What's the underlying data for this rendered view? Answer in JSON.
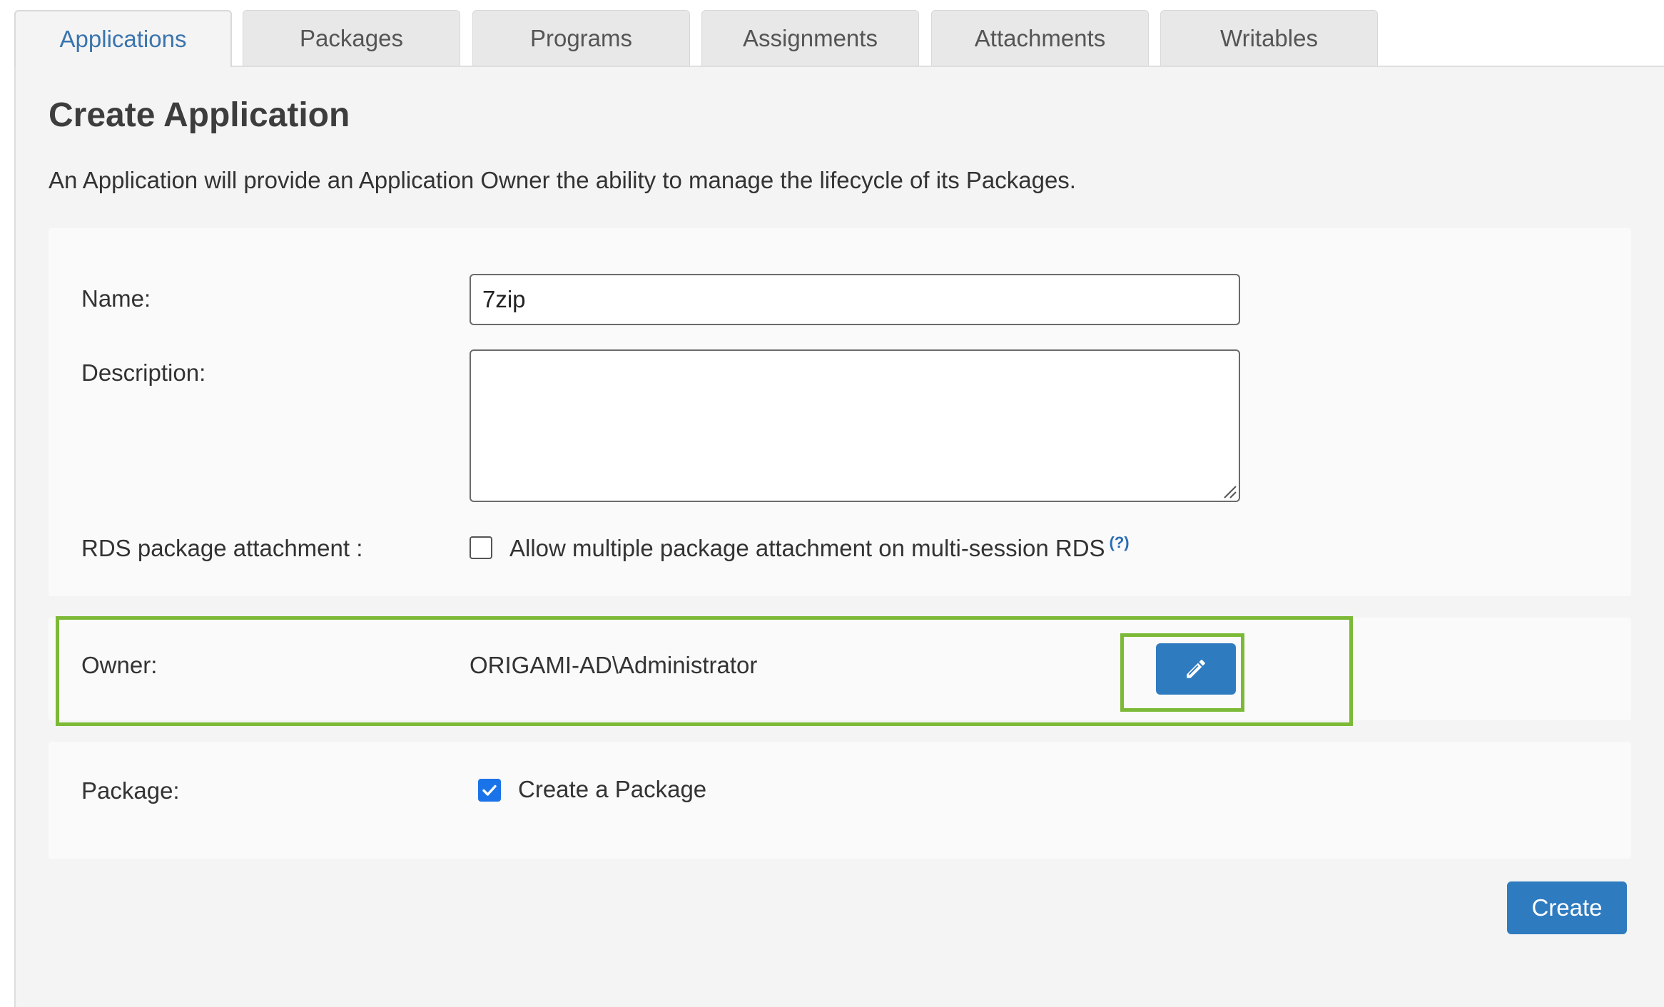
{
  "tabs": [
    {
      "label": "Applications",
      "active": true
    },
    {
      "label": "Packages",
      "active": false
    },
    {
      "label": "Programs",
      "active": false
    },
    {
      "label": "Assignments",
      "active": false
    },
    {
      "label": "Attachments",
      "active": false
    },
    {
      "label": "Writables",
      "active": false
    }
  ],
  "page": {
    "title": "Create Application",
    "description": "An Application will provide an Application Owner the ability to manage the lifecycle of its Packages."
  },
  "form": {
    "name_label": "Name:",
    "name_value": "7zip",
    "description_label": "Description:",
    "description_value": "",
    "rds_label": "RDS package attachment :",
    "rds_checkbox_label": "Allow multiple package attachment on multi-session RDS",
    "rds_help": "(?)",
    "rds_checked": false,
    "owner_label": "Owner:",
    "owner_value": "ORIGAMI-AD\\Administrator",
    "edit_icon": "pencil-icon",
    "package_label": "Package:",
    "package_checkbox_label": "Create a Package",
    "package_checked": true
  },
  "actions": {
    "create_label": "Create"
  },
  "colors": {
    "accent": "#2f7bc0",
    "tab_active_text": "#3a74ad",
    "highlight": "#7cb937",
    "checkbox_checked": "#1a73e8"
  }
}
